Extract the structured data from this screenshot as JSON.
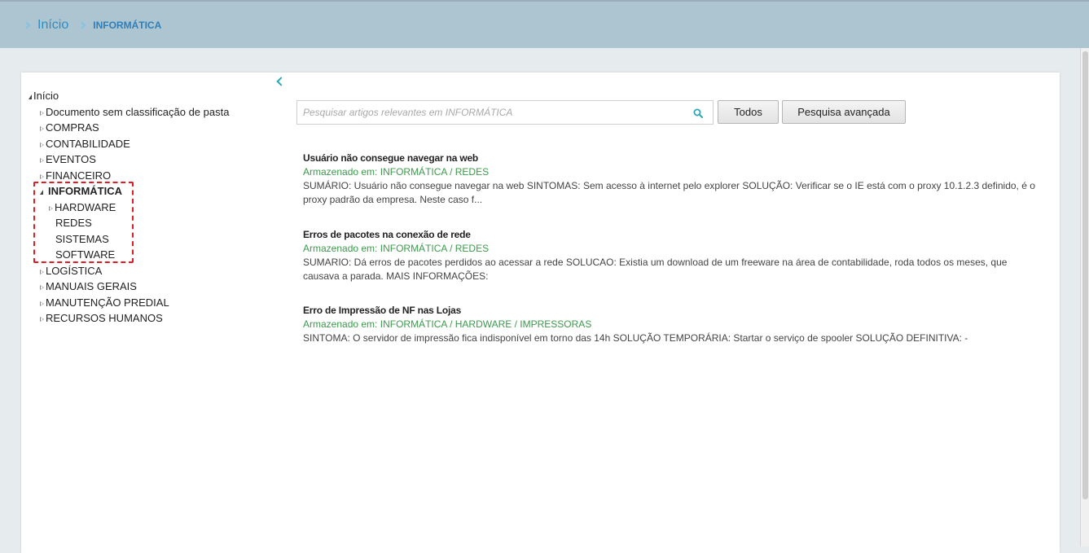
{
  "breadcrumb": {
    "home": "Início",
    "current": "INFORMÁTICA"
  },
  "tree": {
    "root": "Início",
    "items": [
      "Documento sem classificação de pasta",
      "COMPRAS",
      "CONTABILIDADE",
      "EVENTOS",
      "FINANCEIRO",
      "INFORMÁTICA",
      "HARDWARE",
      "REDES",
      "SISTEMAS",
      "SOFTWARE",
      "LOGÍSTICA",
      "MANUAIS GERAIS",
      "MANUTENÇÃO PREDIAL",
      "RECURSOS HUMANOS"
    ]
  },
  "search": {
    "placeholder": "Pesquisar artigos relevantes em INFORMÁTICA",
    "all_label": "Todos",
    "advanced_label": "Pesquisa avançada"
  },
  "articles": [
    {
      "title": "Usuário não consegue navegar na web",
      "location_label": "Armazenado em:",
      "location": "INFORMÁTICA / REDES",
      "summary": "SUMÁRIO: Usuário não consegue navegar na web SINTOMAS: Sem acesso à internet pelo explorer SOLUÇÃO: Verificar se o IE está com o proxy 10.1.2.3 definido, é o proxy padrão da empresa. Neste caso f..."
    },
    {
      "title": "Erros de pacotes na conexão de rede",
      "location_label": "Armazenado em:",
      "location": "INFORMÁTICA / REDES",
      "summary": "SUMARIO: Dá erros de pacotes perdidos ao acessar a rede SOLUCAO: Existia um download de um freeware na área de contabilidade, roda todos os meses, que causava a parada. MAIS INFORMAÇÕES:"
    },
    {
      "title": "Erro de Impressão de NF nas Lojas",
      "location_label": "Armazenado em:",
      "location": "INFORMÁTICA / HARDWARE / IMPRESSORAS",
      "summary": "SINTOMA: O servidor de impressão fica indisponível em torno das 14h SOLUÇÃO TEMPORÁRIA: Startar o serviço de spooler SOLUÇÃO DEFINITIVA: -"
    }
  ]
}
